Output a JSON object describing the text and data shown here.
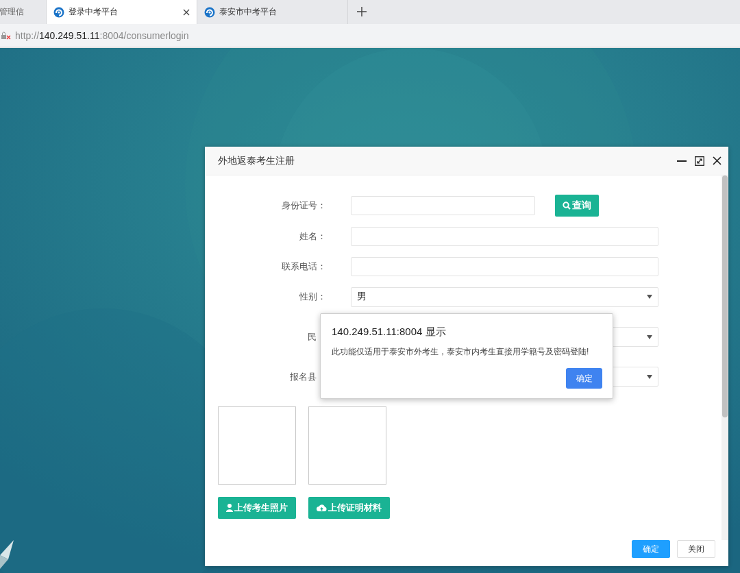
{
  "browser": {
    "tabs": [
      {
        "title": "管理信",
        "selected": false,
        "kind": "cut"
      },
      {
        "title": "登录中考平台",
        "selected": true,
        "kind": "site"
      },
      {
        "title": "泰安市中考平台",
        "selected": false,
        "kind": "site"
      }
    ],
    "address": {
      "scheme": "http://",
      "host": "140.249.51.11",
      "path": ":8004/consumerlogin"
    }
  },
  "dialog": {
    "title": "外地返泰考生注册",
    "fields": [
      {
        "label": "身份证号：",
        "kind": "input",
        "button": "查询"
      },
      {
        "label": "姓名：",
        "kind": "input"
      },
      {
        "label": "联系电话：",
        "kind": "input"
      },
      {
        "label": "性别：",
        "kind": "select",
        "value": "男"
      },
      {
        "label": "民",
        "kind": "select",
        "covered": true
      },
      {
        "label": "报名县",
        "kind": "select",
        "covered": true
      }
    ],
    "uploads": [
      {
        "label": "上传考生照片",
        "kind": "person"
      },
      {
        "label": "上传证明材料",
        "kind": "cloud"
      }
    ],
    "buttons": [
      {
        "label": "确定",
        "kind": "primary"
      },
      {
        "label": "关闭",
        "kind": "plain"
      }
    ]
  },
  "alert": {
    "title": "140.249.51.11:8004 显示",
    "message": "此功能仅适用于泰安市外考生，泰安市内考生直接用学籍号及密码登陆!",
    "button": "确定"
  }
}
